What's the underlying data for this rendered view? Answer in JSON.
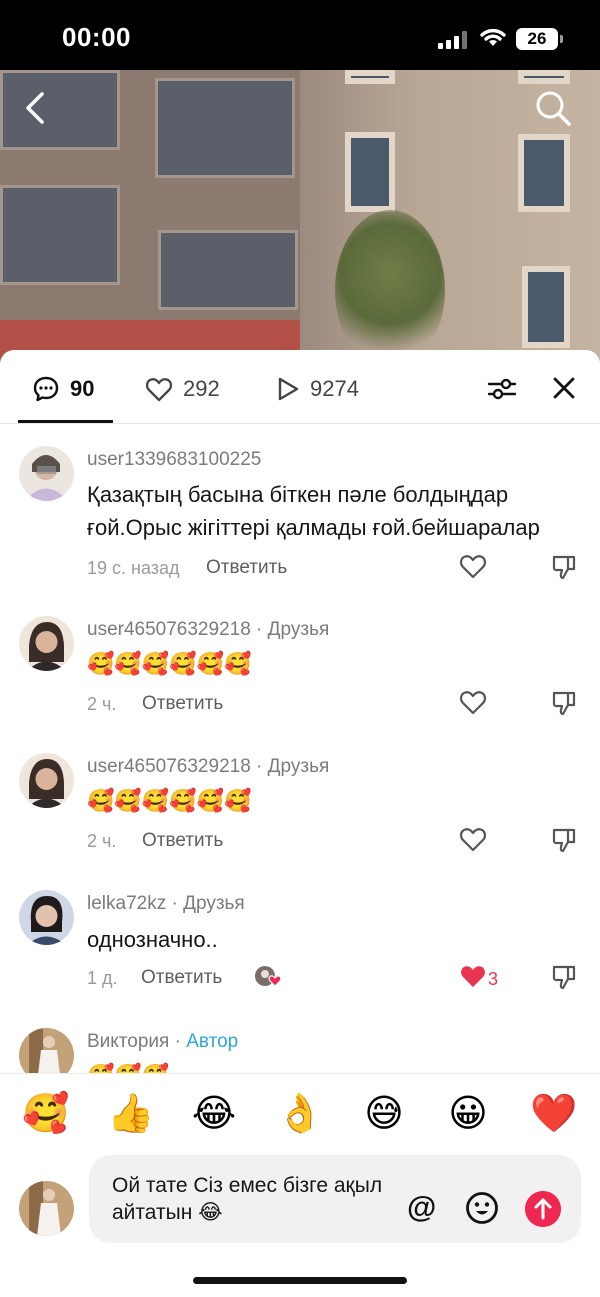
{
  "status_bar": {
    "time": "00:00",
    "battery": "26",
    "icons": [
      "signal-icon",
      "wifi-icon",
      "battery-icon"
    ]
  },
  "video": {
    "icons": [
      "back-arrow-icon",
      "search-icon"
    ]
  },
  "tabs": {
    "comments_count": "90",
    "likes_count": "292",
    "views_count": "9274",
    "icons": [
      "comment-bubble-icon",
      "heart-icon",
      "play-icon",
      "filter-icon",
      "close-icon"
    ]
  },
  "comments": [
    {
      "username": "user1339683100225",
      "tag": "",
      "text": "Қазақтың басына біткен пәле болдыңдар ғой.Орыс жігіттері қалмады ғой.бейшаралар",
      "time": "19 с. назад",
      "reply": "Ответить"
    },
    {
      "username": "user465076329218",
      "tag": " · Друзья",
      "text": "🥰🥰🥰🥰🥰🥰",
      "time": "2 ч.",
      "reply": "Ответить"
    },
    {
      "username": "user465076329218",
      "tag": " · Друзья",
      "text": "🥰🥰🥰🥰🥰🥰",
      "time": "2 ч.",
      "reply": "Ответить"
    },
    {
      "username": "lelka72kz",
      "tag": " · Друзья",
      "text": "однозначно..",
      "time": "1 д.",
      "reply": "Ответить",
      "likes": "3"
    },
    {
      "username": "Виктория",
      "tag": " · ",
      "author_label": "Автор",
      "text": "🥰🥰🥰"
    }
  ],
  "reactions": [
    "🥰",
    "👍",
    "😂",
    "👌",
    "😅",
    "😀",
    "❤️"
  ],
  "composer": {
    "text": "Ой тате Сіз емес бізге ақыл айтатын 😂",
    "at_label": "@",
    "icons": [
      "smile-icon",
      "send-arrow-icon"
    ]
  },
  "colors": {
    "accent_red": "#ee2851",
    "author_blue": "#2aa8d8",
    "liked_heart": "#e8344e"
  }
}
